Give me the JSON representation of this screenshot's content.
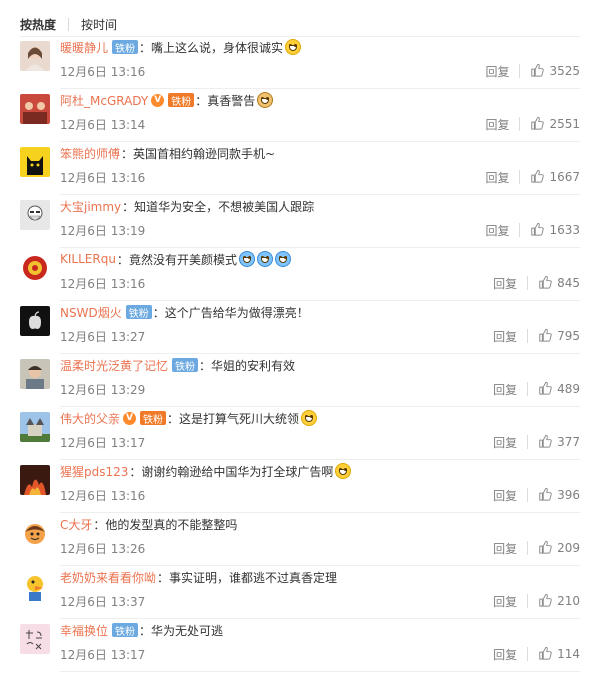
{
  "tabs": {
    "hot": "按热度",
    "time": "按时间"
  },
  "actions": {
    "reply_label": "回复"
  },
  "colors": {
    "username": "#eb7350",
    "fan_badge": "#6ba9e0",
    "meta": "#808080"
  },
  "comments": [
    {
      "user": "暖暖静儿",
      "badge": "铁粉",
      "vip": "",
      "text": "嘴上这么说，身体很诚实",
      "emoji": [
        "grin"
      ],
      "time": "12月6日 13:16",
      "likes": "3525",
      "avatar": "woman-photo"
    },
    {
      "user": "阿杜_McGRADY",
      "badge": "铁粉",
      "vip": "V",
      "text": "真香警告",
      "emoji": [
        "dog"
      ],
      "time": "12月6日 13:14",
      "likes": "2551",
      "avatar": "group-photo"
    },
    {
      "user": "笨熊的师傅",
      "badge": "",
      "vip": "",
      "text": "英国首相约翰逊同款手机~",
      "emoji": [],
      "time": "12月6日 13:16",
      "likes": "1667",
      "avatar": "cat-black-yellow"
    },
    {
      "user": "大宝jimmy",
      "badge": "",
      "vip": "",
      "text": "知道华为安全，不想被美国人跟踪",
      "emoji": [],
      "time": "12月6日 13:19",
      "likes": "1633",
      "avatar": "kfc-man"
    },
    {
      "user": "KILLERqu",
      "badge": "",
      "vip": "",
      "text": "竟然没有开美颜模式",
      "emoji": [
        "tear",
        "tear",
        "tear"
      ],
      "time": "12月6日 13:16",
      "likes": "845",
      "avatar": "red-emblem"
    },
    {
      "user": "NSWD烟火",
      "badge": "铁粉",
      "vip": "",
      "text": "这个广告给华为做得漂亮！",
      "emoji": [],
      "time": "12月6日 13:27",
      "likes": "795",
      "avatar": "apple-dark"
    },
    {
      "user": "温柔时光泛黄了记忆",
      "badge": "铁粉",
      "vip": "",
      "text": "华姐的安利有效",
      "emoji": [],
      "time": "12月6日 13:29",
      "likes": "489",
      "avatar": "boy-photo"
    },
    {
      "user": "伟大的父亲",
      "badge": "铁粉",
      "vip": "V",
      "text": "这是打算气死川大统领",
      "emoji": [
        "grin"
      ],
      "time": "12月6日 13:17",
      "likes": "377",
      "avatar": "castle"
    },
    {
      "user": "猩猩pds123",
      "badge": "",
      "vip": "",
      "text": "谢谢约翰逊给中国华为打全球广告啊",
      "emoji": [
        "grin"
      ],
      "time": "12月6日 13:16",
      "likes": "396",
      "avatar": "fire-scene"
    },
    {
      "user": "C大牙",
      "badge": "",
      "vip": "",
      "text": "他的发型真的不能整整吗",
      "emoji": [],
      "time": "12月6日 13:26",
      "likes": "209",
      "avatar": "cartoon-boy"
    },
    {
      "user": "老奶奶来看看你呦",
      "badge": "",
      "vip": "",
      "text": "事实证明，谁都逃不过真香定理",
      "emoji": [],
      "time": "12月6日 13:37",
      "likes": "210",
      "avatar": "cartoon-duck"
    },
    {
      "user": "幸福换位",
      "badge": "铁粉",
      "vip": "",
      "text": "华为无处可逃",
      "emoji": [],
      "time": "12月6日 13:17",
      "likes": "114",
      "avatar": "handwriting"
    }
  ]
}
